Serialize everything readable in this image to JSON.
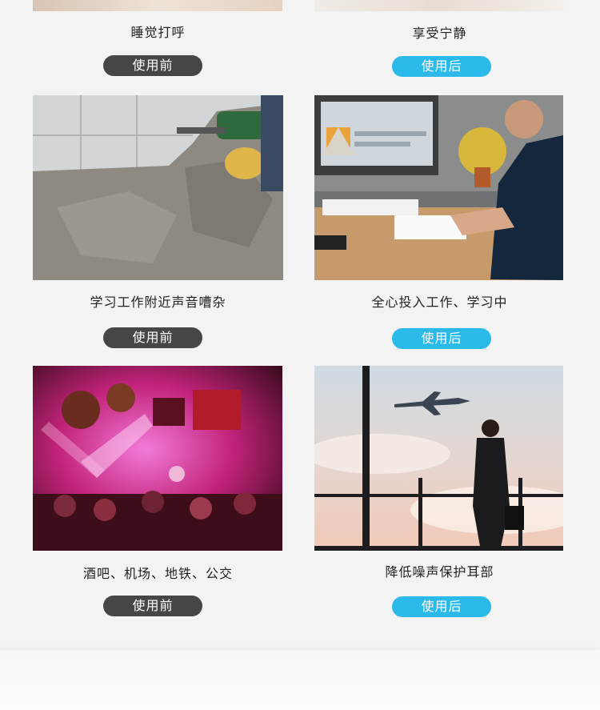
{
  "rows": [
    {
      "left": {
        "caption": "睡觉打呼",
        "button": "使用前"
      },
      "right": {
        "caption": "享受宁静",
        "button": "使用后"
      }
    },
    {
      "left": {
        "caption": "学习工作附近声音嘈杂",
        "button": "使用前"
      },
      "right": {
        "caption": "全心投入工作、学习中",
        "button": "使用后"
      }
    },
    {
      "left": {
        "caption": "酒吧、机场、地铁、公交",
        "button": "使用前"
      },
      "right": {
        "caption": "降低噪声保护耳部",
        "button": "使用后"
      }
    }
  ],
  "colors": {
    "before_button": "#444648",
    "after_button": "#2bb9ea"
  }
}
